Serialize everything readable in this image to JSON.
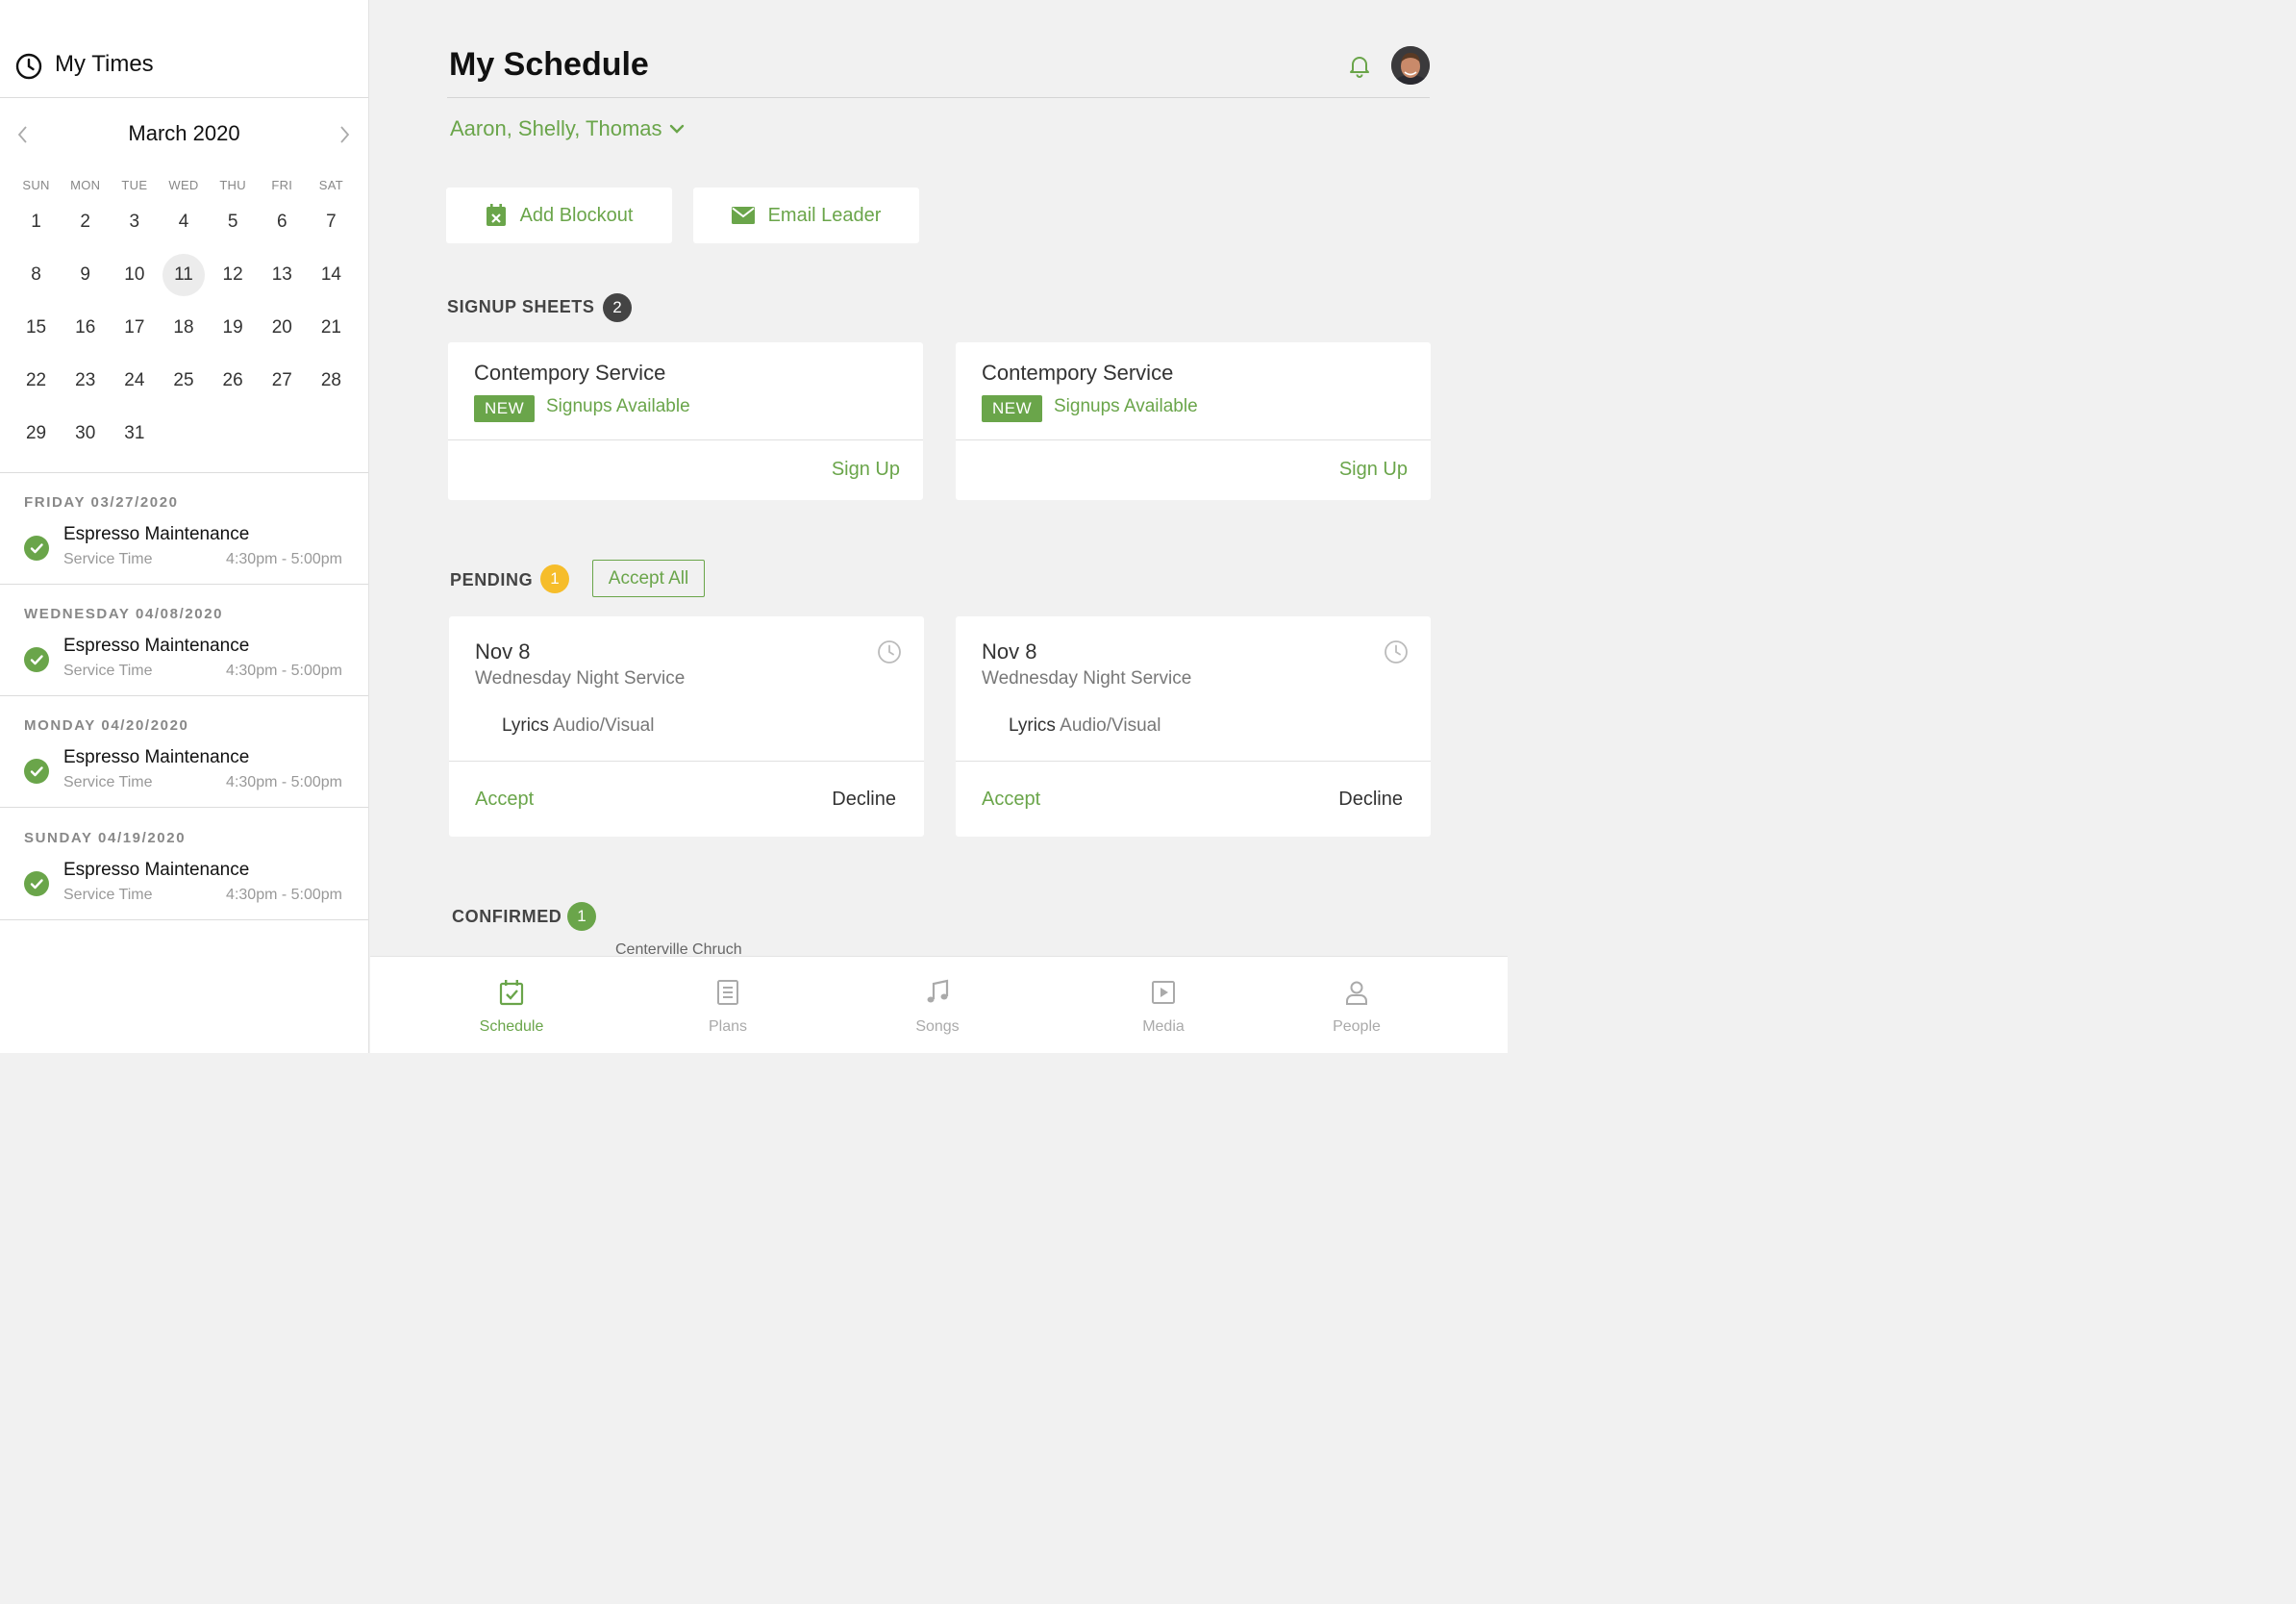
{
  "sidebar": {
    "title": "My Times",
    "calendar": {
      "month_label": "March 2020",
      "weekdays": [
        "SUN",
        "MON",
        "TUE",
        "WED",
        "THU",
        "FRI",
        "SAT"
      ],
      "days": [
        "1",
        "2",
        "3",
        "4",
        "5",
        "6",
        "7",
        "8",
        "9",
        "10",
        "11",
        "12",
        "13",
        "14",
        "15",
        "16",
        "17",
        "18",
        "19",
        "20",
        "21",
        "22",
        "23",
        "24",
        "25",
        "26",
        "27",
        "28",
        "29",
        "30",
        "31"
      ],
      "selected_day": "11"
    },
    "events": [
      {
        "date": "FRIDAY 03/27/2020",
        "name": "Espresso Maintenance",
        "sub": "Service Time",
        "time": "4:30pm - 5:00pm"
      },
      {
        "date": "WEDNESDAY 04/08/2020",
        "name": "Espresso Maintenance",
        "sub": "Service Time",
        "time": "4:30pm - 5:00pm"
      },
      {
        "date": "MONDAY 04/20/2020",
        "name": "Espresso Maintenance",
        "sub": "Service Time",
        "time": "4:30pm - 5:00pm"
      },
      {
        "date": "SUNDAY 04/19/2020",
        "name": "Espresso Maintenance",
        "sub": "Service Time",
        "time": "4:30pm - 5:00pm"
      }
    ]
  },
  "header": {
    "title": "My Schedule",
    "people_filter": "Aaron, Shelly, Thomas"
  },
  "actions": {
    "add_blockout": "Add Blockout",
    "email_leader": "Email Leader"
  },
  "signup_sheets": {
    "label": "SIGNUP SHEETS",
    "count": "2",
    "cards": [
      {
        "title": "Contempory Service",
        "badge": "NEW",
        "status": "Signups Available",
        "action": "Sign Up"
      },
      {
        "title": "Contempory Service",
        "badge": "NEW",
        "status": "Signups Available",
        "action": "Sign Up"
      }
    ]
  },
  "pending": {
    "label": "PENDING",
    "count": "1",
    "accept_all": "Accept All",
    "cards": [
      {
        "date": "Nov 8",
        "service": "Wednesday Night Service",
        "role_primary": "Lyrics",
        "role_secondary": "Audio/Visual",
        "accept": "Accept",
        "decline": "Decline"
      },
      {
        "date": "Nov 8",
        "service": "Wednesday Night Service",
        "role_primary": "Lyrics",
        "role_secondary": "Audio/Visual",
        "accept": "Accept",
        "decline": "Decline"
      }
    ]
  },
  "confirmed": {
    "label": "CONFIRMED",
    "count": "1",
    "peek_text": "Centerville Chruch"
  },
  "tabbar": {
    "tabs": [
      {
        "label": "Schedule",
        "icon": "calendar-check-icon",
        "active": true
      },
      {
        "label": "Plans",
        "icon": "document-list-icon",
        "active": false
      },
      {
        "label": "Songs",
        "icon": "music-note-icon",
        "active": false
      },
      {
        "label": "Media",
        "icon": "play-square-icon",
        "active": false
      },
      {
        "label": "People",
        "icon": "person-icon",
        "active": false
      }
    ]
  },
  "colors": {
    "accent": "#6aa54a",
    "pending_badge": "#f6bd2a",
    "count_badge": "#444444",
    "background": "#f1f1f1"
  }
}
